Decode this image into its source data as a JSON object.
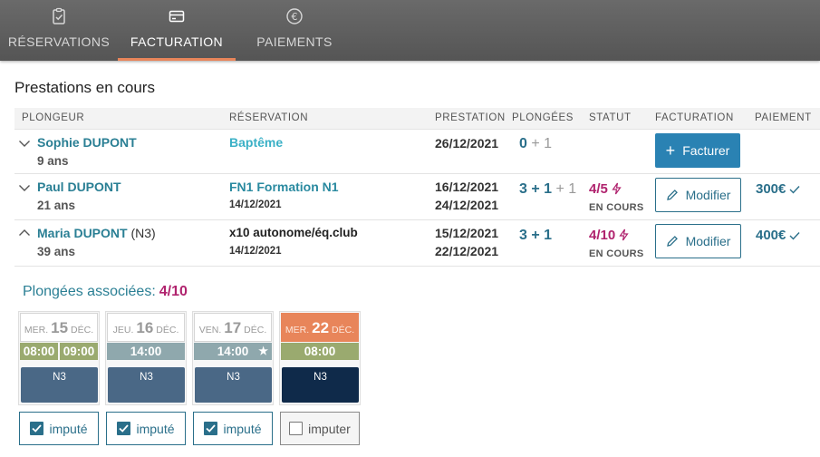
{
  "nav": {
    "tabs": [
      {
        "label": "RÉSERVATIONS",
        "icon": "clipboard-check-icon"
      },
      {
        "label": "FACTURATION",
        "icon": "credit-card-icon"
      },
      {
        "label": "PAIEMENTS",
        "icon": "euro-icon"
      }
    ],
    "active": "FACTURATION",
    "accent": "#e8855a"
  },
  "section_title": "Prestations en cours",
  "table": {
    "headers": [
      "PLONGEUR",
      "RÉSERVATION",
      "PRESTATION",
      "PLONGÉES",
      "STATUT",
      "FACTURATION",
      "PAIEMENT"
    ],
    "rows": [
      {
        "name": "Sophie DUPONT",
        "level": "",
        "age": "9 ans",
        "reservation": "Baptême",
        "reservation_date": "",
        "dates": [
          "26/12/2021"
        ],
        "dives_main": "0",
        "dives_extra": "+ 1",
        "status": "",
        "status_sub": "",
        "action": "Facturer",
        "payment": ""
      },
      {
        "name": "Paul DUPONT",
        "level": "",
        "age": "21 ans",
        "reservation": "FN1 Formation N1",
        "reservation_date": "14/12/2021",
        "dates": [
          "16/12/2021",
          "24/12/2021"
        ],
        "dives_main": "3 + 1",
        "dives_extra": "+ 1",
        "status": "4/5",
        "status_sub": "EN COURS",
        "action": "Modifier",
        "payment": "300€"
      },
      {
        "name": "Maria DUPONT",
        "level": "(N3)",
        "age": "39 ans",
        "reservation": "x10 autonome/éq.club",
        "reservation_date": "14/12/2021",
        "dates": [
          "15/12/2021",
          "22/12/2021"
        ],
        "dives_main": "3 + 1",
        "dives_extra": "",
        "status": "4/10",
        "status_sub": "EN COURS",
        "action": "Modifier",
        "payment": "400€"
      }
    ]
  },
  "associated": {
    "title": "Plongées associées:",
    "count": "4/10",
    "cards": [
      {
        "weekday": "MER.",
        "day": "15",
        "month": "DÉC.",
        "times": [
          "08:00",
          "09:00"
        ],
        "level": "N3",
        "checkbox": "imputé",
        "checked": true
      },
      {
        "weekday": "JEU.",
        "day": "16",
        "month": "DÉC.",
        "times": [
          "14:00"
        ],
        "level": "N3",
        "checkbox": "imputé",
        "checked": true
      },
      {
        "weekday": "VEN.",
        "day": "17",
        "month": "DÉC.",
        "times": [
          "14:00"
        ],
        "level": "N3",
        "checkbox": "imputé",
        "checked": true
      },
      {
        "weekday": "MER.",
        "day": "22",
        "month": "DÉC.",
        "times": [
          "08:00"
        ],
        "level": "N3",
        "checkbox": "imputer",
        "checked": false
      }
    ]
  }
}
